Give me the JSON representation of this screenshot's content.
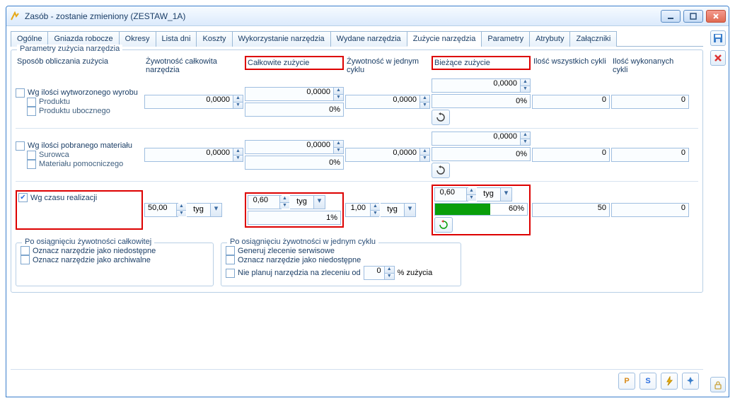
{
  "window": {
    "title": "Zasób - zostanie zmieniony  (ZESTAW_1A)"
  },
  "tabs": [
    "Ogólne",
    "Gniazda robocze",
    "Okresy",
    "Lista dni",
    "Koszty",
    "Wykorzystanie narzędzia",
    "Wydane narzędzia",
    "Zużycie narzędzia",
    "Parametry",
    "Atrybuty",
    "Załączniki"
  ],
  "active_tab": "Zużycie narzędzia",
  "group": {
    "params_label": "Parametry zużycia narzędzia",
    "headers": {
      "method": "Sposób obliczania zużycia",
      "total_life": "Żywotność całkowita narzędzia",
      "total_wear": "Całkowite zużycie",
      "cycle_life": "Żywotność w jednym cyklu",
      "current_wear": "Bieżące zużycie",
      "all_cycles": "Ilość wszystkich cykli",
      "done_cycles": "Ilość wykonanych cykli"
    },
    "row1": {
      "chk_main": "Wg ilości wytworzonego wyrobu",
      "chk_a": "Produktu",
      "chk_b": "Produktu ubocznego",
      "total_life": "0,0000",
      "total_wear": "0,0000",
      "total_pct": "0%",
      "cycle_life": "0,0000",
      "current_wear": "0,0000",
      "current_pct": "0%",
      "all_cycles": "0",
      "done_cycles": "0"
    },
    "row2": {
      "chk_main": "Wg ilości pobranego materiału",
      "chk_a": "Surowca",
      "chk_b": "Materiału pomocniczego",
      "total_life": "0,0000",
      "total_wear": "0,0000",
      "total_pct": "0%",
      "cycle_life": "0,0000",
      "current_wear": "0,0000",
      "current_pct": "0%",
      "all_cycles": "0",
      "done_cycles": "0"
    },
    "row3": {
      "chk_main": "Wg czasu realizacji",
      "checked": true,
      "unit": "tyg",
      "total_life": "50,00",
      "total_wear": "0,60",
      "total_pct": "1%",
      "cycle_life": "1,00",
      "current_wear": "0,60",
      "current_pct": "60%",
      "all_cycles": "50",
      "done_cycles": "0"
    },
    "after_total": {
      "label": "Po osiągnięciu żywotności całkowitej",
      "opt1": "Oznacz narzędzie jako niedostępne",
      "opt2": "Oznacz narzędzie jako archiwalne"
    },
    "after_cycle": {
      "label": "Po osiągnięciu żywotności w jednym cyklu",
      "opt1": "Generuj zlecenie serwisowe",
      "opt2": "Oznacz narzędzie jako niedostępne",
      "opt3": "Nie planuj narzędzia na zleceniu od",
      "opt3_val": "0",
      "opt3_suffix": "% zużycia"
    }
  },
  "footer": {
    "p": "P",
    "s": "S"
  }
}
